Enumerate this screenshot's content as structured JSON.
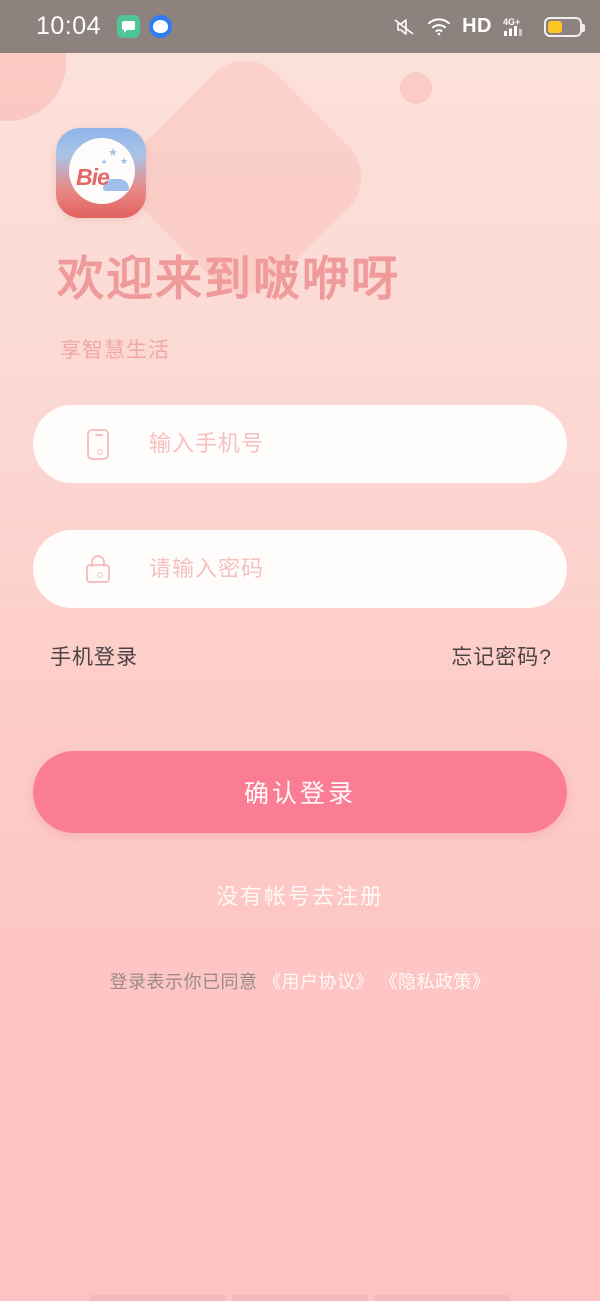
{
  "status_bar": {
    "time": "10:04",
    "hd_label": "HD",
    "network_label": "4G+",
    "icons": [
      "message-app-icon",
      "browser-app-icon",
      "mute-icon",
      "wifi-icon",
      "hd-icon",
      "signal-4g-icon",
      "battery-icon"
    ]
  },
  "logo": {
    "wordmark": "Bie",
    "star": "★"
  },
  "header": {
    "title": "欢迎来到啵咿呀",
    "subtitle": "享智慧生活"
  },
  "form": {
    "phone": {
      "value": "",
      "placeholder": "输入手机号",
      "icon": "phone-icon"
    },
    "password": {
      "value": "",
      "placeholder": "请输入密码",
      "icon": "lock-icon"
    },
    "phone_login_label": "手机登录",
    "forgot_password_label": "忘记密码?",
    "submit_label": "确认登录",
    "register_label": "没有帐号去注册"
  },
  "agreement": {
    "prefix": "登录表示你已同意 ",
    "user_terms": "《用户协议》",
    "separator": " ",
    "privacy_policy": "《隐私政策》"
  },
  "colors": {
    "brand_pink": "#fb7d94",
    "title_pink": "#f09b9b",
    "bg_top": "#fce2db",
    "bg_bottom": "#fdc3c3",
    "field_bg": "#fffdfc",
    "status_bar_bg": "#8d827e",
    "battery_fill": "#ffc426"
  }
}
